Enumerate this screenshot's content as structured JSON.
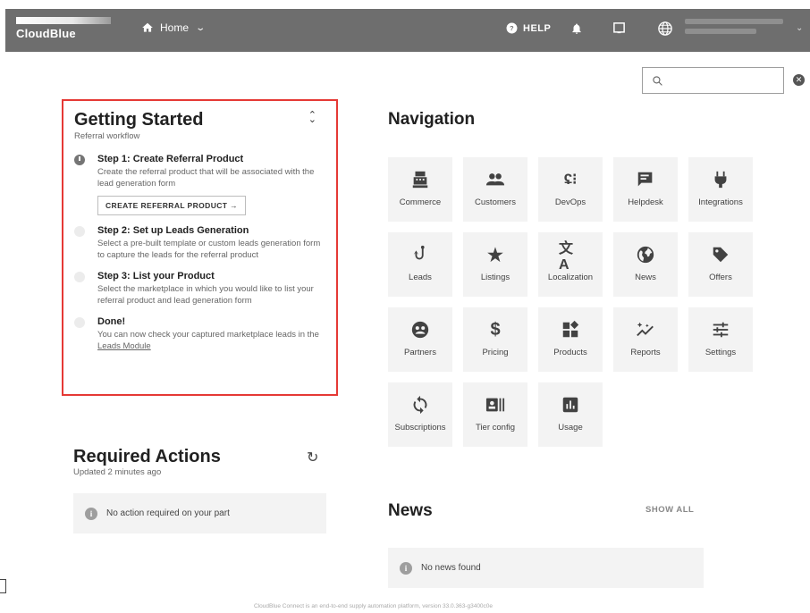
{
  "topbar": {
    "brand": "CloudBlue",
    "home_label": "Home",
    "help_label": "HELP",
    "icons": [
      "home-icon",
      "help-icon",
      "bell-icon",
      "tablet-icon",
      "globe-icon"
    ],
    "bar_color": "#6e6e6e"
  },
  "search": {
    "placeholder": ""
  },
  "getting_started": {
    "title": "Getting Started",
    "subtitle": "Referral workflow",
    "steps": [
      {
        "title": "Step 1: Create Referral Product",
        "desc": "Create the referral product that will be associated with the lead generation form",
        "button": "CREATE REFERRAL PRODUCT →",
        "active": true
      },
      {
        "title": "Step 2: Set up Leads Generation",
        "desc": "Select a pre-built template or custom leads generation form to capture the leads for the referral product",
        "active": false
      },
      {
        "title": "Step 3: List your Product",
        "desc": "Select the marketplace in which you would like to list your referral product and lead generation form",
        "active": false
      },
      {
        "title": "Done!",
        "desc": "You can now check your captured marketplace leads in the",
        "link": "Leads Module",
        "active": false
      }
    ],
    "highlight_color": "#e53935"
  },
  "required_actions": {
    "title": "Required Actions",
    "subtitle": "Updated 2 minutes ago",
    "message": "No action required on your part"
  },
  "navigation": {
    "title": "Navigation",
    "tiles": [
      {
        "label": "Commerce",
        "icon": "register-icon"
      },
      {
        "label": "Customers",
        "icon": "people-icon"
      },
      {
        "label": "DevOps",
        "icon": "devops-icon"
      },
      {
        "label": "Helpdesk",
        "icon": "feedback-icon"
      },
      {
        "label": "Integrations",
        "icon": "plug-icon"
      },
      {
        "label": "Leads",
        "icon": "hook-icon"
      },
      {
        "label": "Listings",
        "icon": "star-icon"
      },
      {
        "label": "Localization",
        "icon": "translate-icon"
      },
      {
        "label": "News",
        "icon": "globe-icon"
      },
      {
        "label": "Offers",
        "icon": "tag-icon"
      },
      {
        "label": "Partners",
        "icon": "handshake-icon"
      },
      {
        "label": "Pricing",
        "icon": "dollar-icon"
      },
      {
        "label": "Products",
        "icon": "widgets-icon"
      },
      {
        "label": "Reports",
        "icon": "sparkline-icon"
      },
      {
        "label": "Settings",
        "icon": "sliders-icon"
      },
      {
        "label": "Subscriptions",
        "icon": "sync-icon"
      },
      {
        "label": "Tier config",
        "icon": "tier-icon"
      },
      {
        "label": "Usage",
        "icon": "bar-chart-icon"
      }
    ]
  },
  "news": {
    "title": "News",
    "show_all": "SHOW ALL",
    "message": "No news found"
  },
  "footer": "CloudBlue Connect is an end-to-end supply automation platform, version 33.0.363-g3400c0e"
}
